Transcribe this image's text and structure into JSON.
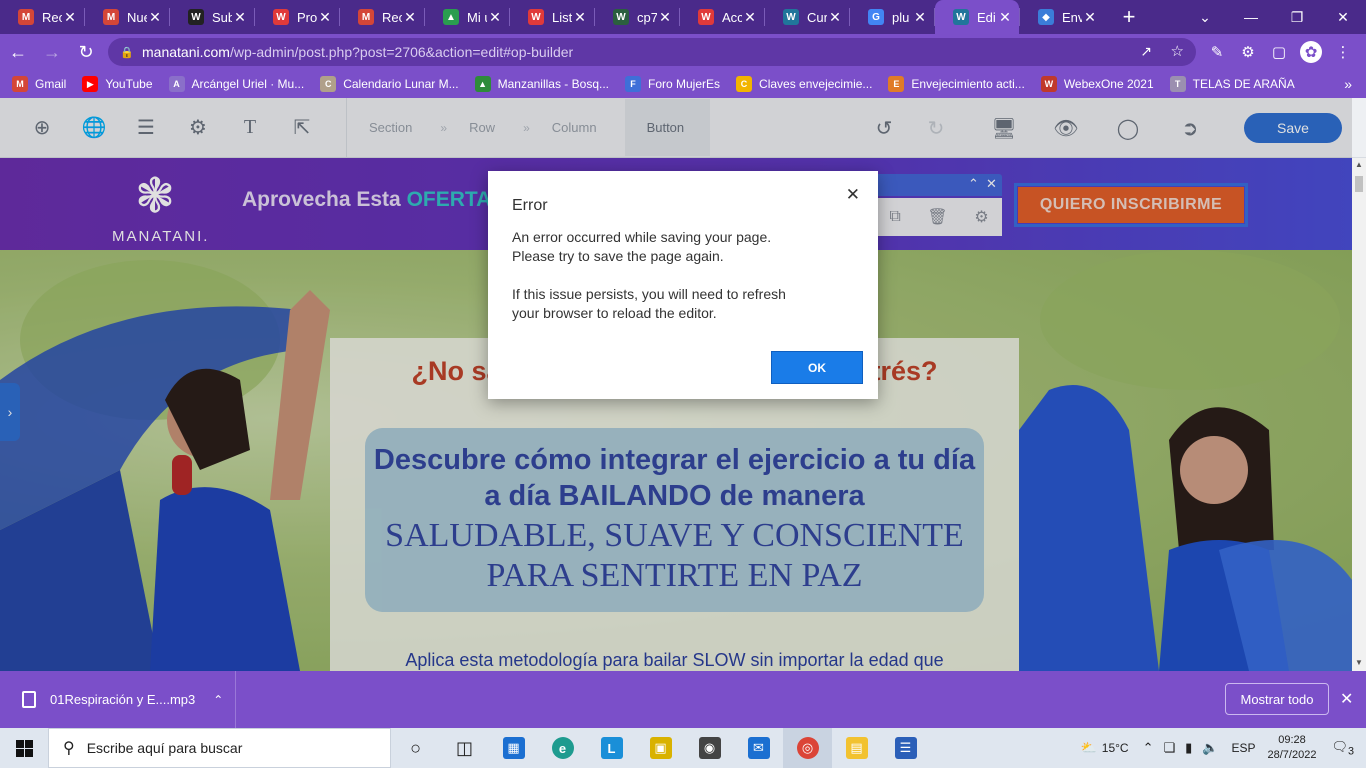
{
  "browser": {
    "tabs": [
      {
        "label": "Rec",
        "icon": "gmail-icon",
        "color": "#d44638",
        "glyph": "M"
      },
      {
        "label": "Nue",
        "icon": "gmail-icon",
        "color": "#d44638",
        "glyph": "M"
      },
      {
        "label": "Sub",
        "icon": "w-icon",
        "color": "#222222",
        "glyph": "W"
      },
      {
        "label": "Pro",
        "icon": "w-icon",
        "color": "#e03a3a",
        "glyph": "W"
      },
      {
        "label": "Rec",
        "icon": "gmail-icon",
        "color": "#d44638",
        "glyph": "M"
      },
      {
        "label": "Mi u",
        "icon": "drive-icon",
        "color": "#2a9d4f",
        "glyph": "▲"
      },
      {
        "label": "List",
        "icon": "w-icon",
        "color": "#e03a3a",
        "glyph": "W"
      },
      {
        "label": "cp7",
        "icon": "w-icon",
        "color": "#2b5f3f",
        "glyph": "W"
      },
      {
        "label": "Acc",
        "icon": "w-icon",
        "color": "#e03a3a",
        "glyph": "W"
      },
      {
        "label": "Cur",
        "icon": "wordpress-icon",
        "color": "#21759b",
        "glyph": "W"
      },
      {
        "label": "plu",
        "icon": "google-icon",
        "color": "#4285f4",
        "glyph": "G"
      },
      {
        "label": "Edi",
        "icon": "wordpress-icon",
        "color": "#21759b",
        "glyph": "W",
        "active": true
      },
      {
        "label": "Env",
        "icon": "shield-icon",
        "color": "#3b7dd8",
        "glyph": "◆"
      }
    ],
    "url_host": "manatani.com",
    "url_path": "/wp-admin/post.php?post=2706&action=edit#op-builder",
    "bookmarks": [
      {
        "label": "Gmail",
        "color": "#d44638",
        "glyph": "M"
      },
      {
        "label": "YouTube",
        "color": "#ff0000",
        "glyph": "▶"
      },
      {
        "label": "Arcángel Uriel · Mu...",
        "color": "#8a6fc9",
        "glyph": "A"
      },
      {
        "label": "Calendario Lunar M...",
        "color": "#b0a08a",
        "glyph": "C"
      },
      {
        "label": "Manzanillas - Bosq...",
        "color": "#2e8b3a",
        "glyph": "▲"
      },
      {
        "label": "Foro MujerEs",
        "color": "#3f6fd8",
        "glyph": "F"
      },
      {
        "label": "Claves envejecimie...",
        "color": "#f2b400",
        "glyph": "C"
      },
      {
        "label": "Envejecimiento acti...",
        "color": "#e07b27",
        "glyph": "E"
      },
      {
        "label": "WebexOne 2021",
        "color": "#c0392b",
        "glyph": "W"
      },
      {
        "label": "TELAS DE ARAÑA",
        "color": "#9b8fb0",
        "glyph": "T"
      }
    ]
  },
  "editor": {
    "breadcrumb": [
      "Section",
      "Row",
      "Column",
      "Button"
    ],
    "save_label": "Save"
  },
  "page": {
    "logo_text": "MANATANI.",
    "offer_prefix": "Aprovecha Esta ",
    "offer_highlight": "OFERTA",
    "cta_label": "QUIERO INSCRIBIRME",
    "hero_question_left": "¿No sa",
    "hero_question_right": "trés?",
    "hero_line1": "Descubre cómo integrar el ejercicio a tu día a día BAILANDO de manera",
    "hero_line2": "SALUDABLE, SUAVE Y CONSCIENTE PARA SENTIRTE EN PAZ",
    "hero_sub": "Aplica esta metodología para bailar SLOW sin importar la edad que"
  },
  "dialog": {
    "title": "Error",
    "message1": "An error occurred while saving your page. Please try to save the page again.",
    "message2": "If this issue persists, you will need to refresh your browser to reload the editor.",
    "ok_label": "OK"
  },
  "downloads": {
    "file_name": "01Respiración y E....mp3",
    "show_all_label": "Mostrar todo"
  },
  "taskbar": {
    "search_placeholder": "Escribe aquí para buscar",
    "temperature": "15°C",
    "language": "ESP",
    "time": "09:28",
    "date": "28/7/2022",
    "notification_count": "3"
  }
}
